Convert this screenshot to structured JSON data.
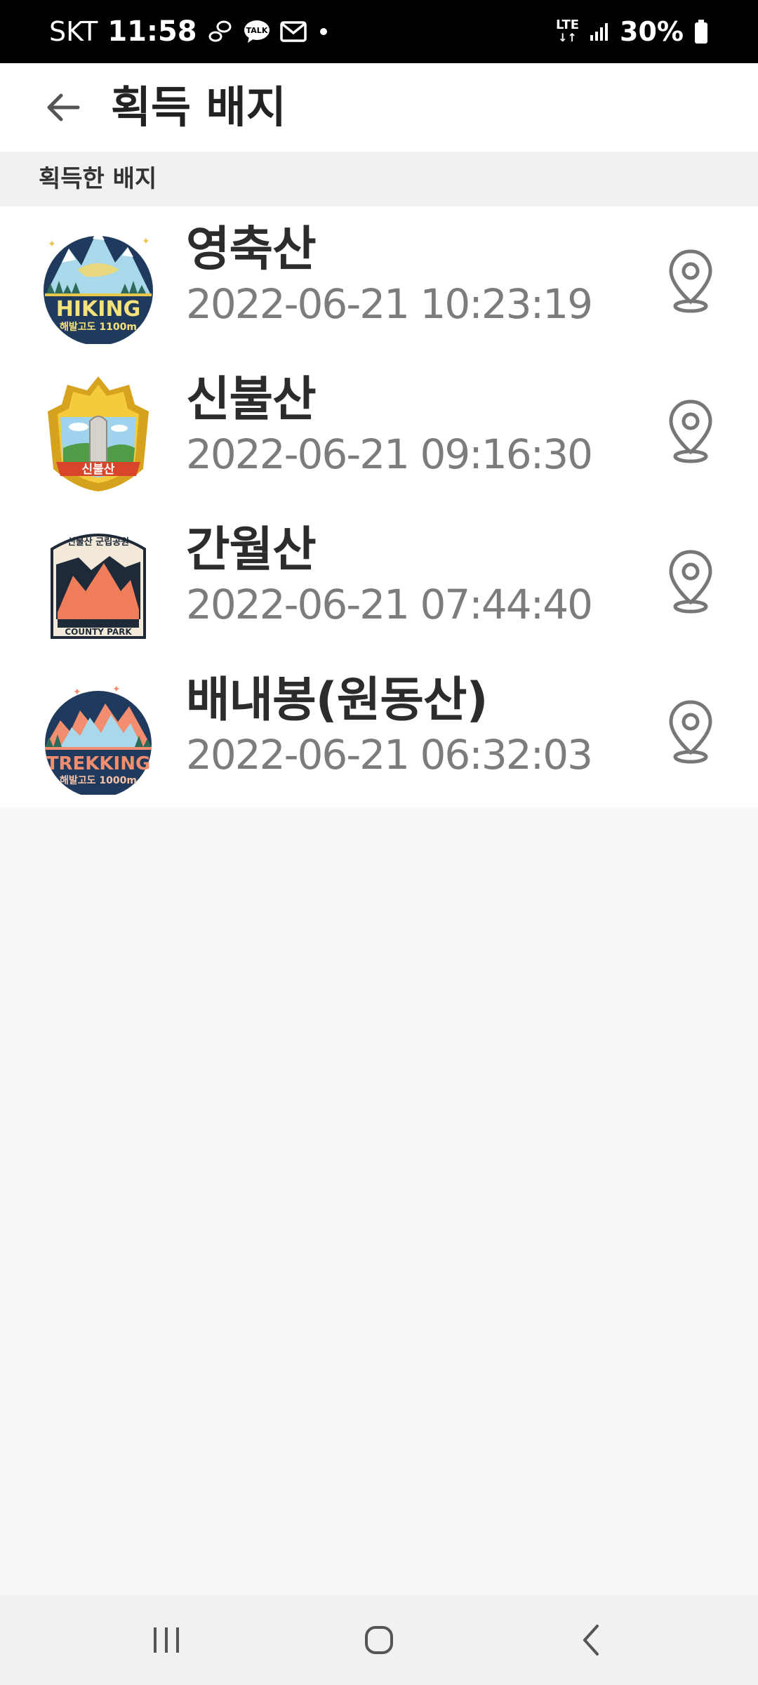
{
  "status_bar": {
    "carrier": "SKT",
    "time": "11:58",
    "network_type": "LTE",
    "battery_percent": "30%",
    "notification_icons": [
      "footprint-icon",
      "kakaotalk-icon",
      "mail-icon",
      "dot-icon"
    ]
  },
  "header": {
    "title": "획득 배지"
  },
  "section": {
    "title": "획득한 배지"
  },
  "badges": [
    {
      "name": "영축산",
      "date": "2022-06-21 10:23:19",
      "badge_text": "HIKING",
      "badge_subtext": "해발고도 1100m",
      "icon": "hiking-badge-icon"
    },
    {
      "name": "신불산",
      "date": "2022-06-21 09:16:30",
      "badge_text": "신불산",
      "badge_subtext": "",
      "icon": "stone-monument-badge-icon"
    },
    {
      "name": "간월산",
      "date": "2022-06-21 07:44:40",
      "badge_text": "COUNTY PARK",
      "badge_subtext": "신불산 군립공원",
      "icon": "county-park-badge-icon"
    },
    {
      "name": "배내봉(원동산)",
      "date": "2022-06-21 06:32:03",
      "badge_text": "TREKKING",
      "badge_subtext": "해발고도 1000m",
      "icon": "trekking-badge-icon"
    }
  ],
  "colors": {
    "accent_dark": "#2c2c2c",
    "date_gray": "#7c7c7c",
    "background": "#f8f8f8"
  }
}
